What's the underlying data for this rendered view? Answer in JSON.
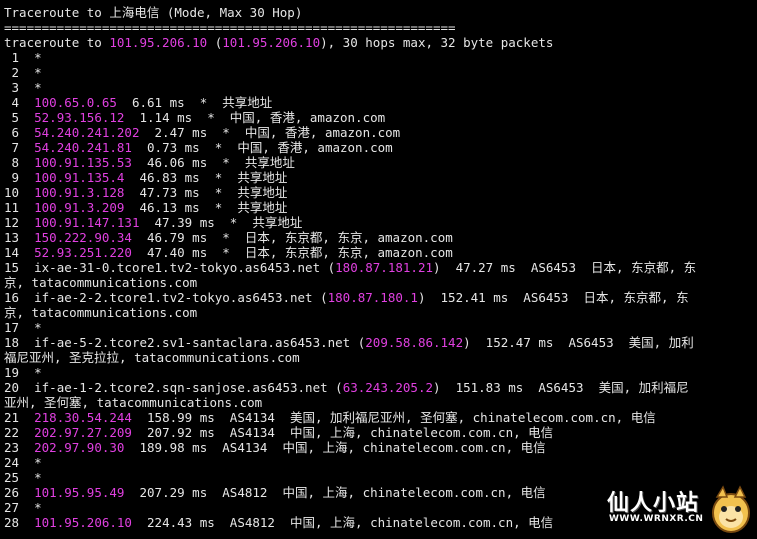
{
  "header": {
    "title": "Traceroute to 上海电信 (Mode, Max 30 Hop)",
    "rule": "============================================================",
    "cmd_prefix": "traceroute to ",
    "cmd_ip": "101.95.206.10",
    "cmd_paren_open": " (",
    "cmd_ip2": "101.95.206.10",
    "cmd_suffix": "), 30 hops max, 32 byte packets"
  },
  "hops": [
    {
      "n": " 1",
      "ip": "",
      "rest": "*"
    },
    {
      "n": " 2",
      "ip": "",
      "rest": "*"
    },
    {
      "n": " 3",
      "ip": "",
      "rest": "*"
    },
    {
      "n": " 4",
      "ip": "100.65.0.65",
      "rest": "  6.61 ms  *  共享地址"
    },
    {
      "n": " 5",
      "ip": "52.93.156.12",
      "rest": "  1.14 ms  *  中国, 香港, amazon.com"
    },
    {
      "n": " 6",
      "ip": "54.240.241.202",
      "rest": "  2.47 ms  *  中国, 香港, amazon.com"
    },
    {
      "n": " 7",
      "ip": "54.240.241.81",
      "rest": "  0.73 ms  *  中国, 香港, amazon.com"
    },
    {
      "n": " 8",
      "ip": "100.91.135.53",
      "rest": "  46.06 ms  *  共享地址"
    },
    {
      "n": " 9",
      "ip": "100.91.135.4",
      "rest": "  46.83 ms  *  共享地址"
    },
    {
      "n": "10",
      "ip": "100.91.3.128",
      "rest": "  47.73 ms  *  共享地址"
    },
    {
      "n": "11",
      "ip": "100.91.3.209",
      "rest": "  46.13 ms  *  共享地址"
    },
    {
      "n": "12",
      "ip": "100.91.147.131",
      "rest": "  47.39 ms  *  共享地址"
    },
    {
      "n": "13",
      "ip": "150.222.90.34",
      "rest": "  46.79 ms  *  日本, 东京都, 东京, amazon.com"
    },
    {
      "n": "14",
      "ip": "52.93.251.220",
      "rest": "  47.40 ms  *  日本, 东京都, 东京, amazon.com"
    }
  ],
  "hop15": {
    "n": "15",
    "host": "ix-ae-31-0.tcore1.tv2-tokyo.as6453.net (",
    "ip": "180.87.181.21",
    "rest": ")  47.27 ms  AS6453  日本, 东京都, 东",
    "cont": "京, tatacommunications.com"
  },
  "hop16": {
    "n": "16",
    "host": "if-ae-2-2.tcore1.tv2-tokyo.as6453.net (",
    "ip": "180.87.180.1",
    "rest": ")  152.41 ms  AS6453  日本, 东京都, 东",
    "cont": "京, tatacommunications.com"
  },
  "hop17": {
    "n": "17",
    "rest": "*"
  },
  "hop18": {
    "n": "18",
    "host": "if-ae-5-2.tcore2.sv1-santaclara.as6453.net (",
    "ip": "209.58.86.142",
    "rest": ")  152.47 ms  AS6453  美国, 加利",
    "cont": "福尼亚州, 圣克拉拉, tatacommunications.com"
  },
  "hop19": {
    "n": "19",
    "rest": "*"
  },
  "hop20": {
    "n": "20",
    "host": "if-ae-1-2.tcore2.sqn-sanjose.as6453.net (",
    "ip": "63.243.205.2",
    "rest": ")  151.83 ms  AS6453  美国, 加利福尼",
    "cont": "亚州, 圣何塞, tatacommunications.com"
  },
  "tail": [
    {
      "n": "21",
      "ip": "218.30.54.244",
      "rest": "  158.99 ms  AS4134  美国, 加利福尼亚州, 圣何塞, chinatelecom.com.cn, 电信"
    },
    {
      "n": "22",
      "ip": "202.97.27.209",
      "rest": "  207.92 ms  AS4134  中国, 上海, chinatelecom.com.cn, 电信"
    },
    {
      "n": "23",
      "ip": "202.97.90.30",
      "rest": "  189.98 ms  AS4134  中国, 上海, chinatelecom.com.cn, 电信"
    },
    {
      "n": "24",
      "ip": "",
      "rest": "*"
    },
    {
      "n": "25",
      "ip": "",
      "rest": "*"
    },
    {
      "n": "26",
      "ip": "101.95.95.49",
      "rest": "  207.29 ms  AS4812  中国, 上海, chinatelecom.com.cn, 电信"
    },
    {
      "n": "27",
      "ip": "",
      "rest": "*"
    },
    {
      "n": "28",
      "ip": "101.95.206.10",
      "rest": "  224.43 ms  AS4812  中国, 上海, chinatelecom.com.cn, 电信"
    }
  ],
  "watermark": {
    "title": "仙人小站",
    "url": "WWW.WRNXR.CN"
  },
  "colors": {
    "ip": "#e040e0",
    "text": "#e6e6e6",
    "background": "#000000"
  }
}
